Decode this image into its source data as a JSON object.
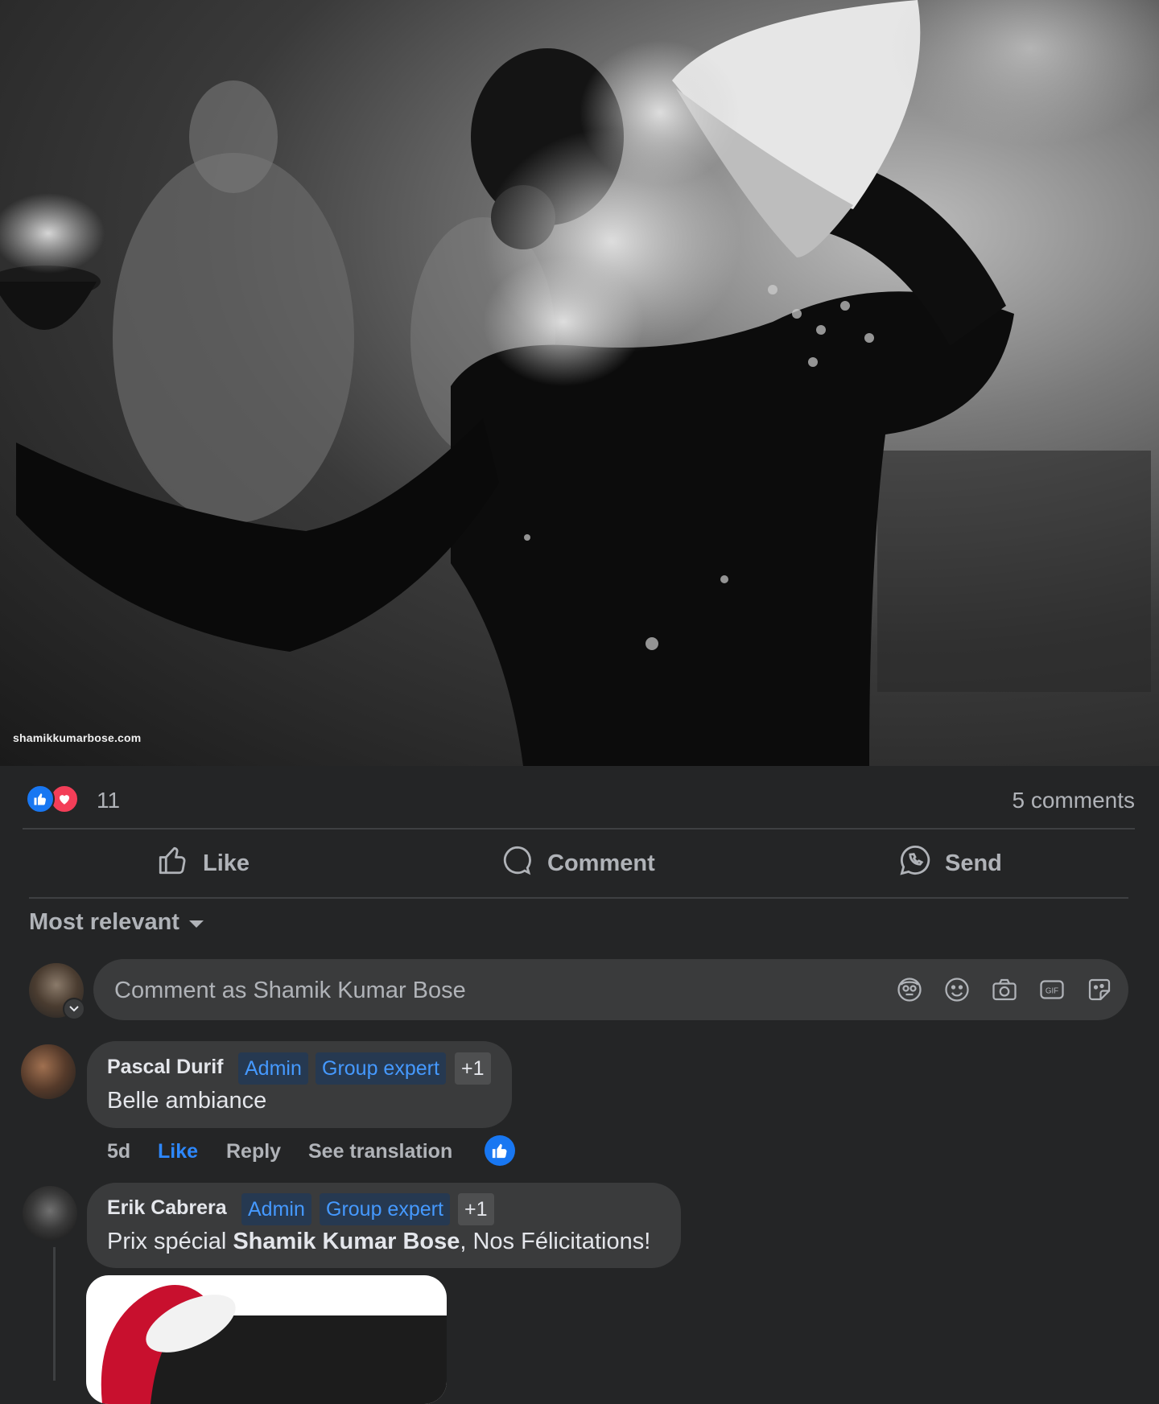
{
  "photo": {
    "watermark": "shamikkumarbose.com"
  },
  "reactions": {
    "count": "11",
    "comments_count": "5 comments",
    "icons": [
      "like-icon",
      "love-icon"
    ]
  },
  "actions": {
    "like": "Like",
    "comment": "Comment",
    "send": "Send"
  },
  "sort": {
    "label": "Most relevant"
  },
  "composer": {
    "placeholder": "Comment as Shamik Kumar Bose",
    "icons": [
      "avatar-sticker-icon",
      "emoji-icon",
      "camera-icon",
      "gif-icon",
      "sticker-icon"
    ]
  },
  "comments": [
    {
      "author": "Pascal Durif",
      "badges": [
        "Admin",
        "Group expert",
        "+1"
      ],
      "text": "Belle ambiance",
      "time": "5d",
      "like": "Like",
      "reply": "Reply",
      "translate": "See translation",
      "liked": true
    },
    {
      "author": "Erik Cabrera",
      "badges": [
        "Admin",
        "Group expert",
        "+1"
      ],
      "text_before": "Prix spécial ",
      "mention": "Shamik Kumar Bose",
      "text_after": ", Nos Félicitations!"
    }
  ],
  "colors": {
    "background": "#242526",
    "surface": "#3a3b3c",
    "accent": "#1877f2",
    "love": "#f33e58",
    "muted_text": "#b0b3b8",
    "badge_text": "#4599ff"
  }
}
